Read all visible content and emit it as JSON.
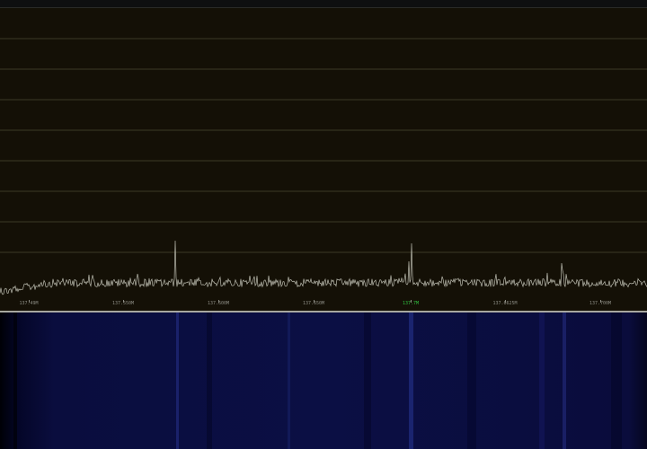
{
  "spectrum": {
    "tick_labels": [
      "137.49M",
      "137.550M",
      "137.600M",
      "137.650M",
      "137.7M",
      "137.6625M",
      "137.700M"
    ],
    "center_tick_index": 4,
    "grid_color": "#3c3a26",
    "trace_color": "#bcbcb0",
    "background_color": "#141006",
    "center_label_color": "#2fbf3f"
  },
  "waterfall": {
    "base_color": "#0b0f44"
  }
}
